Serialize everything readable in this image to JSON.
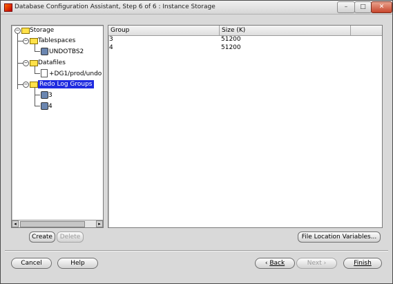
{
  "window": {
    "title": "Database Configuration Assistant, Step 6 of 6 : Instance Storage",
    "minimize_label": "–",
    "maximize_label": "□",
    "close_label": "✕"
  },
  "tree": {
    "root": "Storage",
    "tablespaces": "Tablespaces",
    "tablespace_item": "UNDOTBS2",
    "datafiles": "Datafiles",
    "datafile_item": "+DG1/prod/undo",
    "redo_log_groups": "Redo Log Groups",
    "redo_items": [
      "3",
      "4"
    ],
    "expanded_symbol": "−",
    "scroll_left": "◂",
    "scroll_right": "▸"
  },
  "table": {
    "columns": [
      "Group",
      "Size (K)"
    ],
    "rows": [
      {
        "group": "3",
        "size": "51200"
      },
      {
        "group": "4",
        "size": "51200"
      }
    ]
  },
  "buttons": {
    "create": "Create",
    "delete": "Delete",
    "file_location_variables": "File Location Variables...",
    "cancel": "Cancel",
    "help": "Help",
    "back_arrow": "‹",
    "back": "Back",
    "next": "Next",
    "next_arrow": "›",
    "finish": "Finish"
  }
}
